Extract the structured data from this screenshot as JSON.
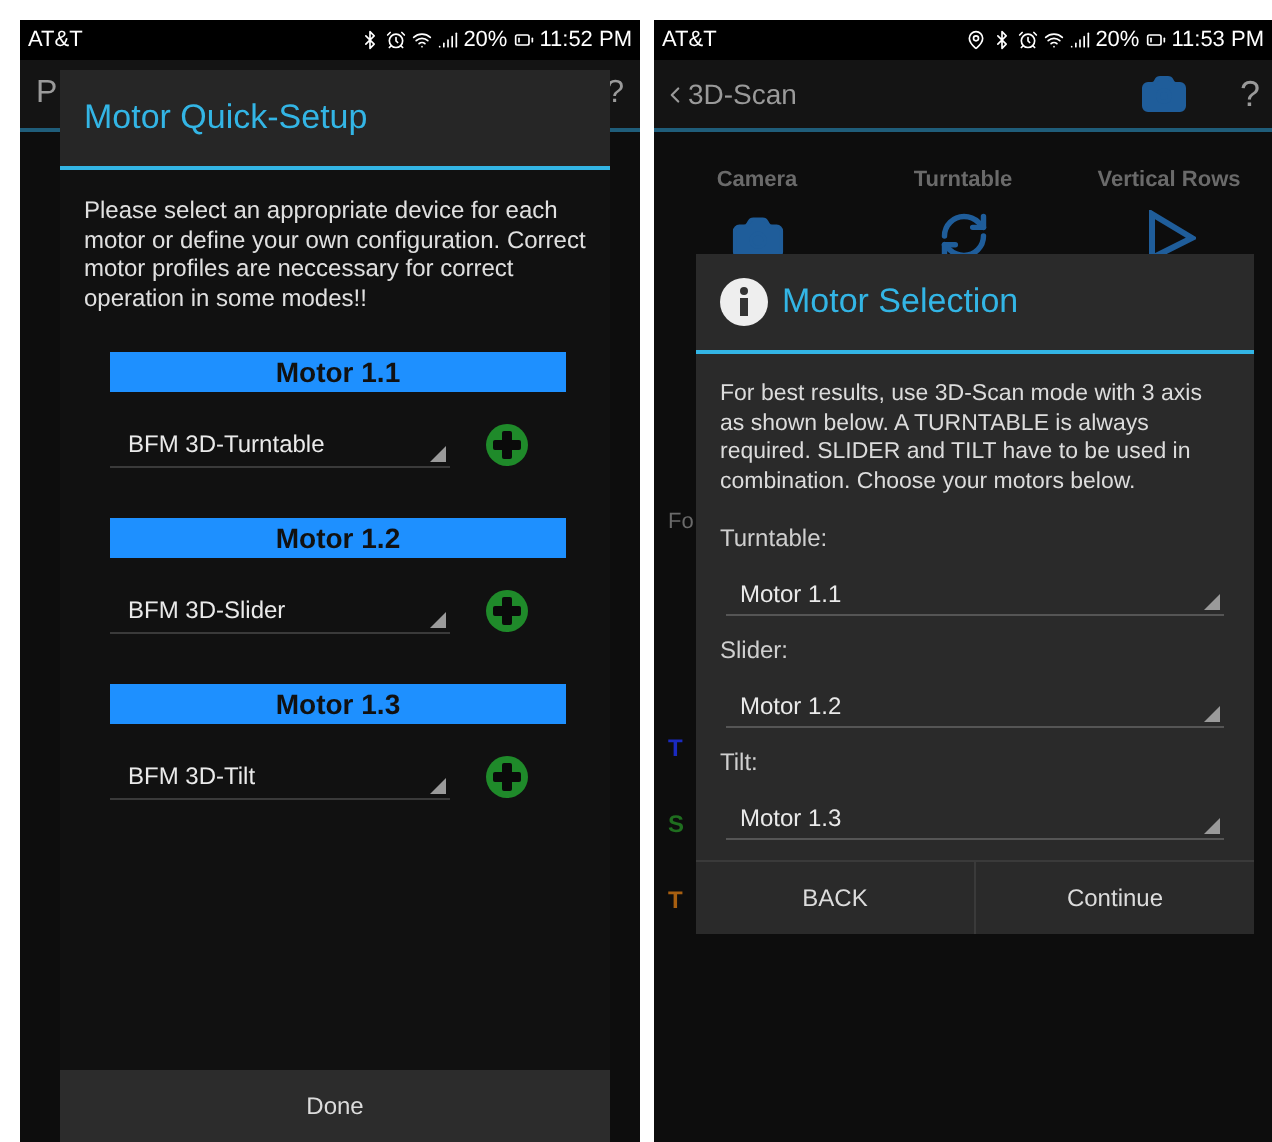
{
  "left_screen": {
    "status_bar": {
      "carrier": "AT&T",
      "battery": "20%",
      "time": "11:52 PM"
    },
    "app_bar": {
      "title": "P",
      "help": "?"
    },
    "dialog": {
      "title": "Motor Quick-Setup",
      "message": "Please select an appropriate device for each motor or define your own configuration. Correct motor profiles are neccessary for correct operation in some modes!!",
      "motors": [
        {
          "heading": "Motor 1.1",
          "device": "BFM 3D-Turntable"
        },
        {
          "heading": "Motor 1.2",
          "device": "BFM 3D-Slider"
        },
        {
          "heading": "Motor 1.3",
          "device": "BFM 3D-Tilt"
        }
      ],
      "button": "Done"
    }
  },
  "right_screen": {
    "status_bar": {
      "carrier": "AT&T",
      "battery": "20%",
      "time": "11:53 PM"
    },
    "app_bar": {
      "title": "3D-Scan",
      "help": "?"
    },
    "tabs": [
      {
        "label": "Camera",
        "kind": "camera"
      },
      {
        "label": "Turntable",
        "kind": "rotate"
      },
      {
        "label": "Vertical Rows",
        "kind": "tilt"
      }
    ],
    "background_rows": [
      {
        "text": "Fo",
        "color": "#6a6a6a"
      },
      {
        "text": "T",
        "color": "#1a2ac0"
      },
      {
        "text": "S",
        "color": "#1f6e1f"
      },
      {
        "text": "T",
        "color": "#a85f10"
      }
    ],
    "dialog": {
      "title": "Motor Selection",
      "message": "For best results, use 3D-Scan mode with 3 axis as shown below. A TURNTABLE is always required. SLIDER and TILT have to be used in combination. Choose your motors below.",
      "fields": [
        {
          "label": "Turntable:",
          "value": "Motor 1.1"
        },
        {
          "label": "Slider:",
          "value": "Motor 1.2"
        },
        {
          "label": "Tilt:",
          "value": "Motor 1.3"
        }
      ],
      "buttons": [
        "BACK",
        "Continue"
      ]
    }
  }
}
